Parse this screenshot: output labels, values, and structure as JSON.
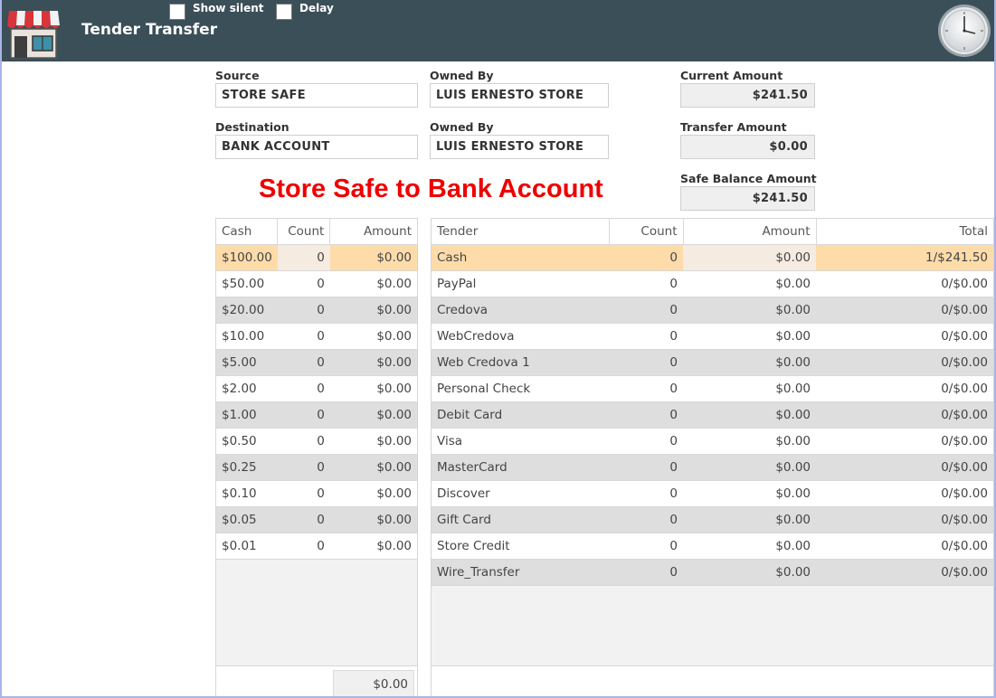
{
  "app": {
    "title": "Tender Transfer",
    "show_silent_label": "Show silent",
    "delay_label": "Delay",
    "header_bg": "#3b4f58"
  },
  "form": {
    "source_label": "Source",
    "source_value": "STORE SAFE",
    "owned_by_label": "Owned By",
    "source_owner": "LUIS ERNESTO STORE",
    "current_amount_label": "Current Amount",
    "current_amount": "$241.50",
    "destination_label": "Destination",
    "destination_value": "BANK ACCOUNT",
    "destination_owner": "LUIS ERNESTO STORE",
    "transfer_amount_label": "Transfer Amount",
    "transfer_amount": "$0.00",
    "safe_balance_label": "Safe Balance Amount",
    "safe_balance": "$241.50"
  },
  "transfer_title": "Store Safe to Bank Account",
  "transfer_title_color": "#ee0000",
  "cash_table": {
    "headers": [
      "Cash",
      "Count",
      "Amount"
    ],
    "rows": [
      [
        "$100.00",
        "0",
        "$0.00"
      ],
      [
        "$50.00",
        "0",
        "$0.00"
      ],
      [
        "$20.00",
        "0",
        "$0.00"
      ],
      [
        "$10.00",
        "0",
        "$0.00"
      ],
      [
        "$5.00",
        "0",
        "$0.00"
      ],
      [
        "$2.00",
        "0",
        "$0.00"
      ],
      [
        "$1.00",
        "0",
        "$0.00"
      ],
      [
        "$0.50",
        "0",
        "$0.00"
      ],
      [
        "$0.25",
        "0",
        "$0.00"
      ],
      [
        "$0.10",
        "0",
        "$0.00"
      ],
      [
        "$0.05",
        "0",
        "$0.00"
      ],
      [
        "$0.01",
        "0",
        "$0.00"
      ]
    ],
    "total": "$0.00"
  },
  "tender_table": {
    "headers": [
      "Tender",
      "Count",
      "Amount",
      "Total"
    ],
    "rows": [
      [
        "Cash",
        "0",
        "$0.00",
        "1/$241.50"
      ],
      [
        "PayPal",
        "0",
        "$0.00",
        "0/$0.00"
      ],
      [
        "Credova",
        "0",
        "$0.00",
        "0/$0.00"
      ],
      [
        "WebCredova",
        "0",
        "$0.00",
        "0/$0.00"
      ],
      [
        "Web Credova 1",
        "0",
        "$0.00",
        "0/$0.00"
      ],
      [
        "Personal Check",
        "0",
        "$0.00",
        "0/$0.00"
      ],
      [
        "Debit Card",
        "0",
        "$0.00",
        "0/$0.00"
      ],
      [
        "Visa",
        "0",
        "$0.00",
        "0/$0.00"
      ],
      [
        "MasterCard",
        "0",
        "$0.00",
        "0/$0.00"
      ],
      [
        "Discover",
        "0",
        "$0.00",
        "0/$0.00"
      ],
      [
        "Gift Card",
        "0",
        "$0.00",
        "0/$0.00"
      ],
      [
        "Store Credit",
        "0",
        "$0.00",
        "0/$0.00"
      ],
      [
        "Wire_Transfer",
        "0",
        "$0.00",
        "0/$0.00"
      ]
    ]
  },
  "selection_color": "#fedcaa"
}
